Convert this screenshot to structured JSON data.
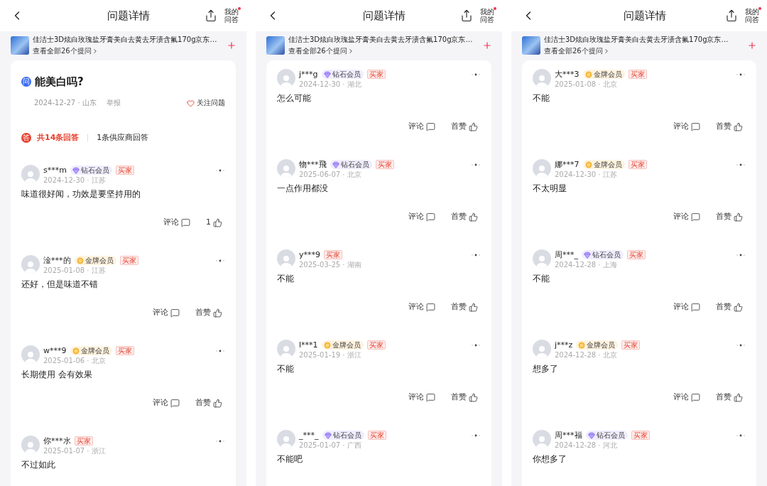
{
  "screens": [
    {
      "header": {
        "title": "问题详情",
        "my_qa": "我的问答",
        "has_notification": true
      },
      "product": {
        "title": "佳洁士3D炫白玫瑰盐牙膏美白去黄去牙渍含氟170g京东…",
        "link": "查看全部26个提问"
      },
      "question": {
        "icon": "问",
        "title": "能美白吗?",
        "meta": "2024-12-27 · 山东",
        "report": "举报",
        "follow": "关注问题"
      },
      "answer_tabs": {
        "icon": "答",
        "tabs": [
          {
            "label": "共14条回答",
            "selected": true
          },
          {
            "label": "1条供应商回答",
            "selected": false
          }
        ]
      },
      "answers": [
        {
          "name": "s***m",
          "badge": {
            "kind": "diamond",
            "label": "钻石会员"
          },
          "tag": "买家",
          "meta": "2024-12-30 · 江苏",
          "text": "味道很好闻，功效是要坚持用的",
          "comment": "评论",
          "like": "1"
        },
        {
          "name": "淦***的",
          "badge": {
            "kind": "gold",
            "label": "金牌会员"
          },
          "tag": "买家",
          "meta": "2025-01-08 · 江苏",
          "text": "还好，但是味道不错",
          "comment": "评论",
          "like": "首赞"
        },
        {
          "name": "w***9",
          "badge": {
            "kind": "gold",
            "label": "金牌会员"
          },
          "tag": "买家",
          "meta": "2025-01-06 · 北京",
          "text": "长期使用 会有效果",
          "comment": "评论",
          "like": "首赞"
        },
        {
          "name": "你***水",
          "tag": "买家",
          "meta": "2025-01-07 · 浙江",
          "text": "不过如此"
        }
      ]
    },
    {
      "header": {
        "title": "问题详情",
        "my_qa": "我的问答",
        "has_notification": true
      },
      "product": {
        "title": "佳洁士3D炫白玫瑰盐牙膏美白去黄去牙渍含氟170g京东…",
        "link": "查看全部26个提问"
      },
      "answers": [
        {
          "name": "j***g",
          "badge": {
            "kind": "diamond",
            "label": "钻石会员"
          },
          "tag": "买家",
          "meta": "2024-12-30 · 湖北",
          "text": "怎么可能",
          "comment": "评论",
          "like": "首赞"
        },
        {
          "name": "物***飛",
          "badge": {
            "kind": "diamond",
            "label": "钻石会员"
          },
          "tag": "买家",
          "meta": "2025-06-07 · 北京",
          "text": "一点作用都没",
          "comment": "评论",
          "like": "首赞"
        },
        {
          "name": "y***9",
          "tag": "买家",
          "meta": "2025-03-25 · 湖南",
          "text": "不能",
          "comment": "评论",
          "like": "首赞"
        },
        {
          "name": "l***1",
          "badge": {
            "kind": "gold",
            "label": "金牌会员"
          },
          "tag": "买家",
          "meta": "2025-01-19 · 浙江",
          "text": "不能",
          "comment": "评论",
          "like": "首赞"
        },
        {
          "name": "_***_",
          "badge": {
            "kind": "diamond",
            "label": "钻石会员"
          },
          "tag": "买家",
          "meta": "2025-01-07 · 广西",
          "text": "不能吧"
        }
      ]
    },
    {
      "header": {
        "title": "问题详情",
        "my_qa": "我的问答",
        "has_notification": true
      },
      "product": {
        "title": "佳洁士3D炫白玫瑰盐牙膏美白去黄去牙渍含氟170g京东…",
        "link": "查看全部26个提问"
      },
      "answers": [
        {
          "name": "大***3",
          "badge": {
            "kind": "gold",
            "label": "金牌会员"
          },
          "tag": "买家",
          "meta": "2025-01-08 · 北京",
          "text": "不能",
          "comment": "评论",
          "like": "首赞"
        },
        {
          "name": "娜***7",
          "badge": {
            "kind": "gold",
            "label": "金牌会员"
          },
          "tag": "买家",
          "meta": "2024-12-30 · 江苏",
          "text": "不太明显",
          "comment": "评论",
          "like": "首赞"
        },
        {
          "name": "周***_",
          "badge": {
            "kind": "diamond",
            "label": "钻石会员"
          },
          "tag": "买家",
          "meta": "2024-12-28 · 上海",
          "text": "不能",
          "comment": "评论",
          "like": "首赞"
        },
        {
          "name": "j***z",
          "badge": {
            "kind": "gold",
            "label": "金牌会员"
          },
          "tag": "买家",
          "meta": "2024-12-28 · 北京",
          "text": "想多了",
          "comment": "评论",
          "like": "首赞"
        },
        {
          "name": "周***福",
          "badge": {
            "kind": "diamond",
            "label": "钻石会员"
          },
          "tag": "买家",
          "meta": "2024-12-28 · 河北",
          "text": "你想多了"
        }
      ]
    }
  ]
}
